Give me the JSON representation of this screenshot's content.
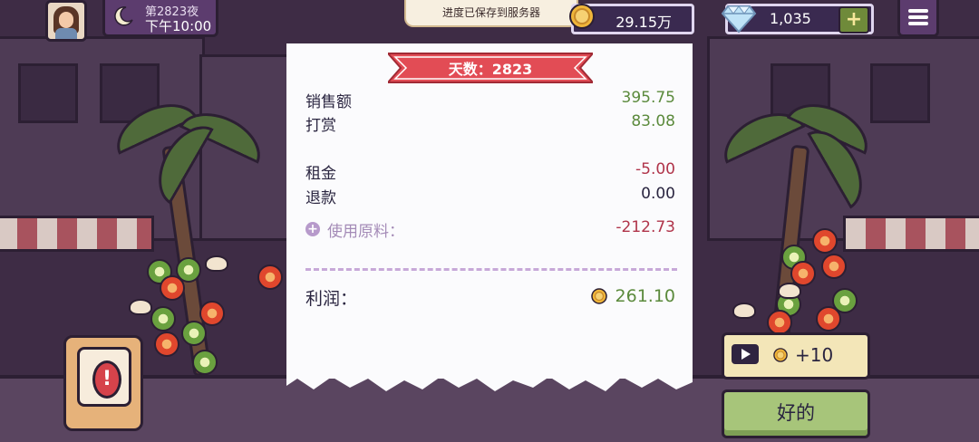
{
  "topbar": {
    "night_label": "第2823夜",
    "time_label": "下午10:00",
    "toast": "进度已保存到服务器",
    "coins": "29.15万",
    "gems": "1,035",
    "gem_plus": "+"
  },
  "receipt": {
    "day_banner": "天数：2823",
    "rows": [
      {
        "label": "销售额",
        "value": "395.75"
      },
      {
        "label": "打赏",
        "value": "83.08"
      },
      {
        "label": "租金",
        "value": "-5.00"
      },
      {
        "label": "退款",
        "value": "0.00"
      }
    ],
    "ingredients_plus": "+",
    "ingredients_label": "使用原料：",
    "ingredients_value": "-212.73",
    "profit_label": "利润：",
    "profit_value": "261.10"
  },
  "alert": {
    "mark": "!"
  },
  "ad_button": {
    "label": "+10"
  },
  "ok_button": {
    "label": "好的"
  },
  "colors": {
    "profit_green": "#5b8a3c",
    "loss_red": "#b0344a",
    "banner_red": "#e24c55"
  }
}
